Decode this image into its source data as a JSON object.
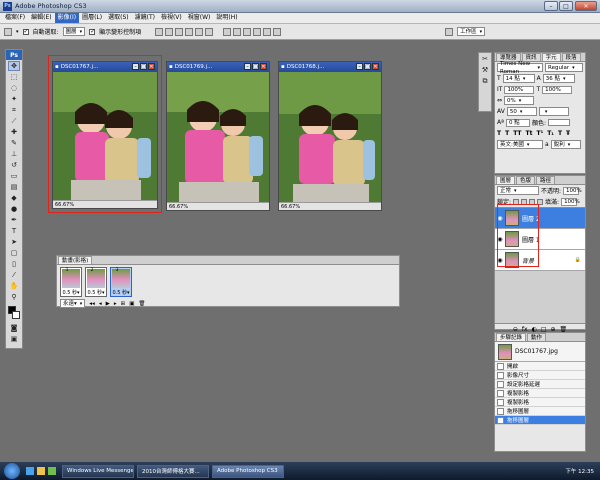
{
  "app": {
    "title": "Adobe Photoshop CS3",
    "badge": "Ps"
  },
  "window_controls": {
    "minimize": "–",
    "maximize": "□",
    "close": "✕"
  },
  "menu": [
    "檔案(F)",
    "編輯(E)",
    "影像(I)",
    "圖層(L)",
    "選取(S)",
    "濾鏡(T)",
    "檢視(V)",
    "視窗(W)",
    "說明(H)"
  ],
  "menu_active_index": 2,
  "options_bar": {
    "auto_select_label": "自動選取:",
    "auto_select_checked": true,
    "auto_select_value": "圖層",
    "show_transform_label": "顯示變形控制項",
    "show_transform_checked": true,
    "workspace_label": "工作區"
  },
  "toolbox": {
    "header": "Ps",
    "tools": [
      {
        "name": "move-tool-icon",
        "glyph": "✥"
      },
      {
        "name": "marquee-tool-icon",
        "glyph": "⬚"
      },
      {
        "name": "lasso-tool-icon",
        "glyph": "◌"
      },
      {
        "name": "magic-wand-tool-icon",
        "glyph": "✦"
      },
      {
        "name": "crop-tool-icon",
        "glyph": "⌗"
      },
      {
        "name": "slice-tool-icon",
        "glyph": "⟋"
      },
      {
        "name": "healing-tool-icon",
        "glyph": "✚"
      },
      {
        "name": "brush-tool-icon",
        "glyph": "✎"
      },
      {
        "name": "stamp-tool-icon",
        "glyph": "⊥"
      },
      {
        "name": "history-brush-tool-icon",
        "glyph": "↺"
      },
      {
        "name": "eraser-tool-icon",
        "glyph": "▭"
      },
      {
        "name": "gradient-tool-icon",
        "glyph": "▤"
      },
      {
        "name": "blur-tool-icon",
        "glyph": "◆"
      },
      {
        "name": "dodge-tool-icon",
        "glyph": "●"
      },
      {
        "name": "pen-tool-icon",
        "glyph": "✒"
      },
      {
        "name": "type-tool-icon",
        "glyph": "T"
      },
      {
        "name": "path-select-tool-icon",
        "glyph": "➤"
      },
      {
        "name": "shape-tool-icon",
        "glyph": "▢"
      },
      {
        "name": "notes-tool-icon",
        "glyph": "▯"
      },
      {
        "name": "eyedropper-tool-icon",
        "glyph": "⁄"
      },
      {
        "name": "hand-tool-icon",
        "glyph": "✋"
      },
      {
        "name": "zoom-tool-icon",
        "glyph": "⚲"
      }
    ],
    "fg_color": "#000000",
    "bg_color": "#ffffff"
  },
  "documents": [
    {
      "title": "DSC01767.j...",
      "zoom": "66.67%",
      "highlighted": true
    },
    {
      "title": "DSC01769.j...",
      "zoom": "66.67%",
      "highlighted": false
    },
    {
      "title": "DSC01768.j...",
      "zoom": "66.67%",
      "highlighted": false
    }
  ],
  "animation": {
    "title": "動畫(影格)",
    "frames": [
      {
        "num": "1",
        "delay": "0.5 秒▾"
      },
      {
        "num": "2",
        "delay": "0.5 秒▾"
      },
      {
        "num": "3",
        "delay": "0.5 秒▾"
      }
    ],
    "loop": "永遠▾",
    "controls": [
      "◂◂",
      "◂",
      "▶",
      "▸",
      "⊞",
      "▣",
      "🗑"
    ]
  },
  "char_panel": {
    "tabs": [
      "導覽器",
      "資訊",
      "字元",
      "段落"
    ],
    "active_tab": 2,
    "font": "Times New Roman",
    "style": "Regular",
    "size": "14 點",
    "leading": "36 點",
    "vscale": "100%",
    "hscale": "100%",
    "tracking_pct": "0%",
    "tracking": "50",
    "baseline": "0 點",
    "color_label": "顏色:",
    "style_buttons": [
      "T",
      "T",
      "TT",
      "Tt",
      "T¹",
      "T₁",
      "T",
      "Ŧ"
    ],
    "lang": "英文:美國",
    "aa": "a",
    "aa_mode": "銳利"
  },
  "layers_panel": {
    "tabs": [
      "圖層",
      "色版",
      "路徑"
    ],
    "active_tab": 0,
    "blend": "正常",
    "opacity_label": "不透明:",
    "opacity": "100%",
    "lock_label": "鎖定:",
    "fill_label": "填滿:",
    "fill": "100%",
    "unify_label": "統一:",
    "propagate_label": "傳播影格 1",
    "layers": [
      {
        "name": "圖層 2",
        "active": true,
        "visible": true,
        "locked": false
      },
      {
        "name": "圖層 1",
        "active": false,
        "visible": true,
        "locked": false
      },
      {
        "name": "背景",
        "active": false,
        "visible": true,
        "locked": true
      }
    ],
    "bottom_icons": [
      "⊖",
      "fx",
      "◐",
      "□",
      "⊕",
      "🗑"
    ]
  },
  "history_panel": {
    "tabs": [
      "步驟記錄",
      "動作"
    ],
    "active_tab": 0,
    "snapshot": "DSC01767.jpg",
    "items": [
      {
        "label": "開啟",
        "active": false
      },
      {
        "label": "影像尺寸",
        "active": false
      },
      {
        "label": "設定影格延遲",
        "active": false
      },
      {
        "label": "複製影格",
        "active": false
      },
      {
        "label": "複製影格",
        "active": false
      },
      {
        "label": "拖移圖層",
        "active": false
      },
      {
        "label": "拖移圖層",
        "active": true
      }
    ]
  },
  "taskbar": {
    "buttons": [
      {
        "label": "Windows Live Messenger",
        "active": false
      },
      {
        "label": "2010台灣師傅格大賽...",
        "active": false
      },
      {
        "label": "Adobe Photoshop CS3",
        "active": true
      }
    ],
    "clock": "下午 12:35"
  },
  "colors": {
    "workspace": "#6f6f6f",
    "accent": "#3d7fe0",
    "highlight_box": "#e0241b"
  }
}
